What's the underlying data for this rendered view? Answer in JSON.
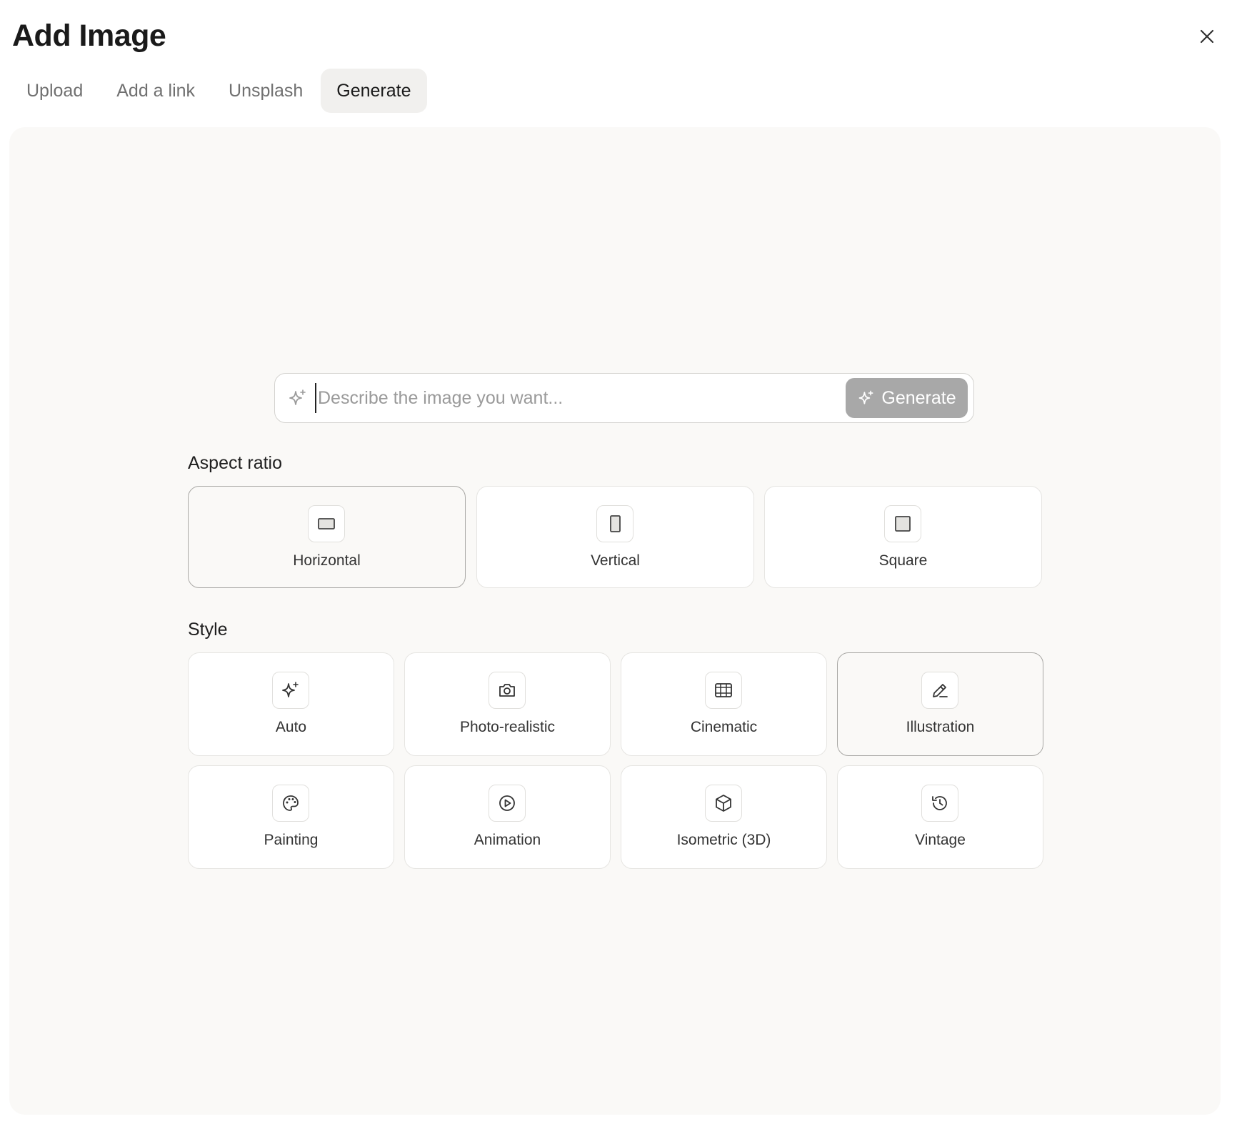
{
  "dialog": {
    "title": "Add Image"
  },
  "tabs": [
    {
      "label": "Upload",
      "active": false
    },
    {
      "label": "Add a link",
      "active": false
    },
    {
      "label": "Unsplash",
      "active": false
    },
    {
      "label": "Generate",
      "active": true
    }
  ],
  "prompt": {
    "placeholder": "Describe the image you want...",
    "value": "",
    "button_label": "Generate",
    "button_icon": "sparkle-icon"
  },
  "aspect_ratio": {
    "label": "Aspect ratio",
    "options": [
      {
        "label": "Horizontal",
        "icon": "horizontal-rect-icon",
        "selected": true
      },
      {
        "label": "Vertical",
        "icon": "vertical-rect-icon",
        "selected": false
      },
      {
        "label": "Square",
        "icon": "square-icon",
        "selected": false
      }
    ]
  },
  "style": {
    "label": "Style",
    "options": [
      {
        "label": "Auto",
        "icon": "sparkle-icon",
        "selected": false
      },
      {
        "label": "Photo-realistic",
        "icon": "camera-icon",
        "selected": false
      },
      {
        "label": "Cinematic",
        "icon": "film-icon",
        "selected": false
      },
      {
        "label": "Illustration",
        "icon": "pencil-icon",
        "selected": true
      },
      {
        "label": "Painting",
        "icon": "palette-icon",
        "selected": false
      },
      {
        "label": "Animation",
        "icon": "play-circle-icon",
        "selected": false
      },
      {
        "label": "Isometric (3D)",
        "icon": "cube-icon",
        "selected": false
      },
      {
        "label": "Vintage",
        "icon": "history-icon",
        "selected": false
      }
    ]
  },
  "colors": {
    "panel_bg": "#faf9f7",
    "active_tab_bg": "#f1f0ee",
    "generate_button_bg": "#a8a8a8",
    "selected_border": "#a9a8a5"
  }
}
